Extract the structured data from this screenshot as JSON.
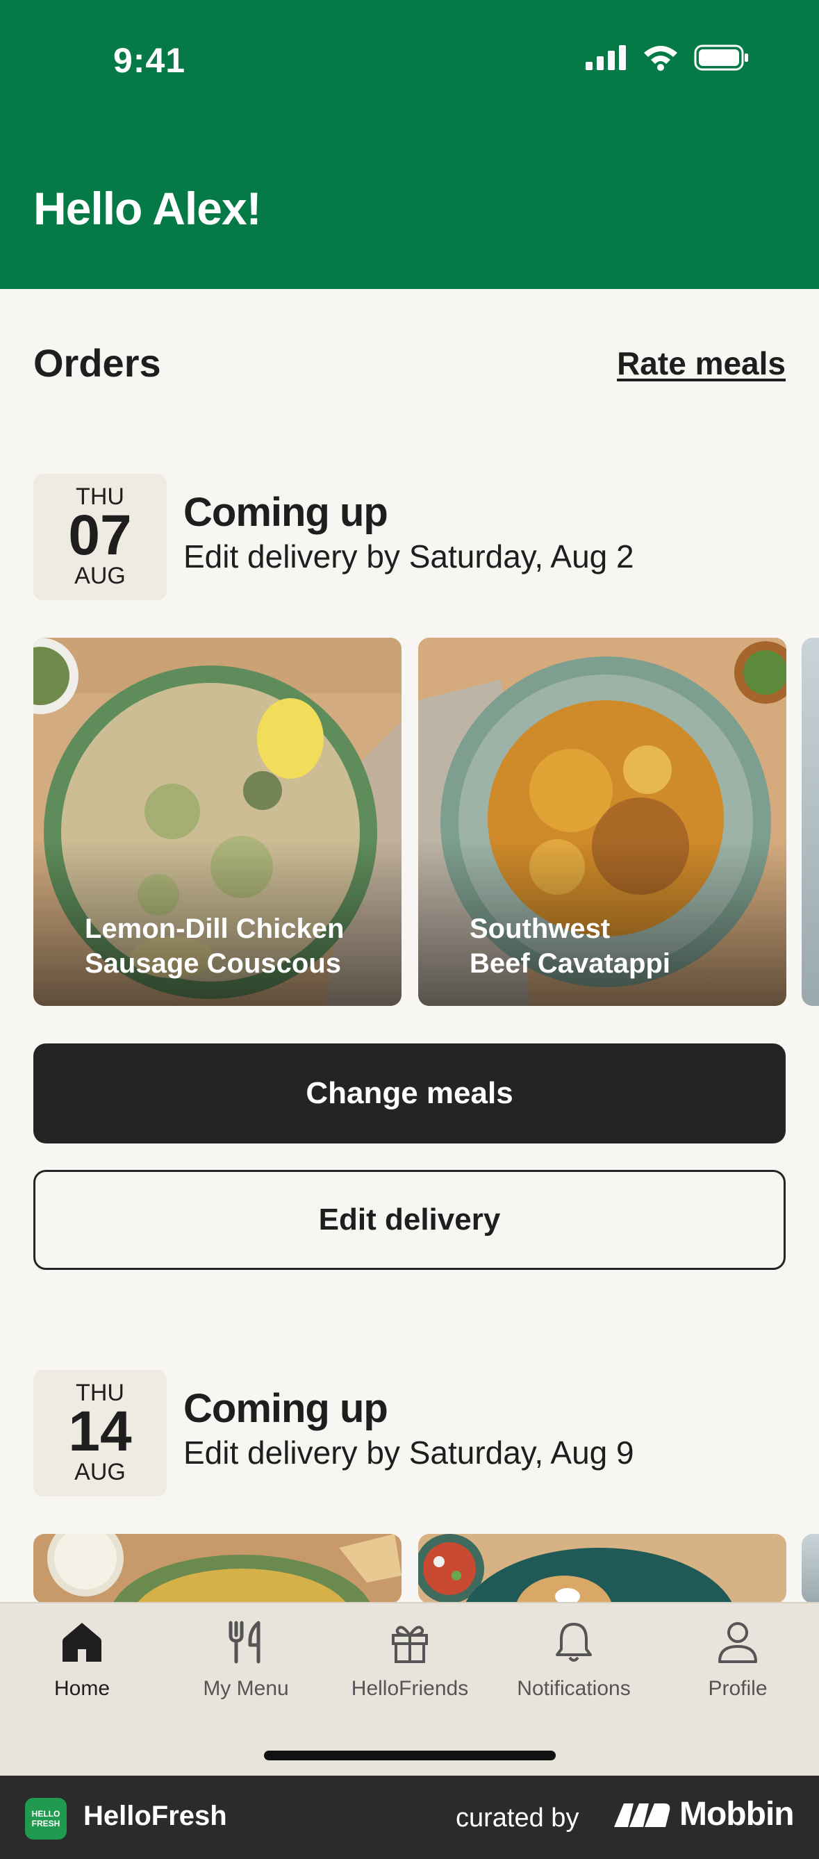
{
  "status_bar": {
    "time": "9:41"
  },
  "header": {
    "greeting": "Hello Alex!"
  },
  "orders": {
    "title": "Orders",
    "rate_link": "Rate meals",
    "deliveries": [
      {
        "dow": "THU",
        "day": "07",
        "month": "AUG",
        "heading": "Coming up",
        "subtitle": "Edit delivery by Saturday, Aug 2",
        "meals": [
          {
            "line1": "Lemon-Dill Chicken",
            "line2": "Sausage Couscous"
          },
          {
            "line1": "Southwest",
            "line2": "Beef Cavatappi"
          }
        ],
        "primary_button": "Change meals",
        "secondary_button": "Edit delivery"
      },
      {
        "dow": "THU",
        "day": "14",
        "month": "AUG",
        "heading": "Coming up",
        "subtitle": "Edit delivery by Saturday, Aug 9"
      }
    ]
  },
  "tabbar": {
    "items": [
      {
        "label": "Home",
        "icon": "home-icon",
        "active": true
      },
      {
        "label": "My Menu",
        "icon": "fork-knife-icon"
      },
      {
        "label": "HelloFriends",
        "icon": "gift-icon"
      },
      {
        "label": "Notifications",
        "icon": "bell-icon"
      },
      {
        "label": "Profile",
        "icon": "person-icon"
      }
    ]
  },
  "footer": {
    "logo_text": "HELLO FRESH",
    "app_name": "HelloFresh",
    "curated_by": "curated by",
    "brand": "Mobbin"
  },
  "colors": {
    "header_green": "#067a46",
    "button_dark": "#242424",
    "background": "#f8f6f2",
    "tabbar": "#e9e4db"
  }
}
